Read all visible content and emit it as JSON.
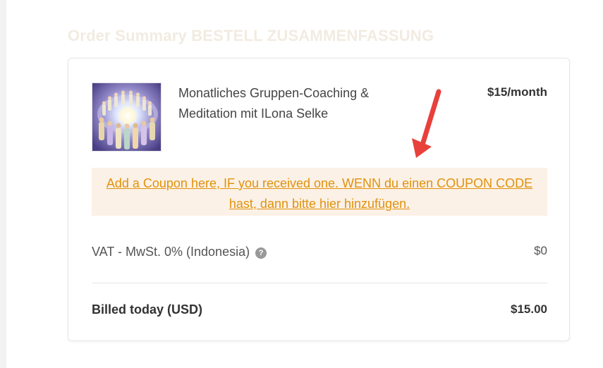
{
  "order_summary": {
    "title": "Order Summary BESTELL ZUSAMMENFASSUNG",
    "product": {
      "name": "Monatliches Gruppen-Coaching & Meditation mit ILona Selke",
      "price": "$15/month",
      "image": "meditation-circle-image"
    },
    "coupon": {
      "link_text": "Add a Coupon here, IF you received one. WENN du einen COUPON CODE hast, dann bitte hier hinzufügen."
    },
    "vat": {
      "label": "VAT - MwSt. 0% (Indonesia)",
      "help_icon": "?",
      "value": "$0"
    },
    "total": {
      "label": "Billed today (USD)",
      "value": "$15.00"
    }
  },
  "colors": {
    "title": "#f2ebe1",
    "coupon_link": "#e0920c",
    "coupon_background": "#fcf1e6",
    "annotation_arrow": "#e8403b"
  }
}
